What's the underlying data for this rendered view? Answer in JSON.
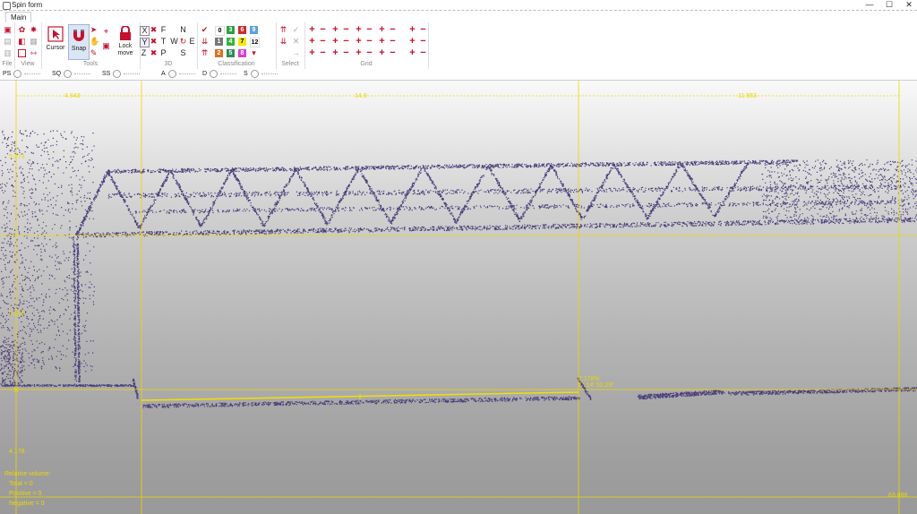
{
  "window": {
    "title": "Spin form",
    "buttons": {
      "minimize": "—",
      "maximize": "☐",
      "close": "✕"
    }
  },
  "tabs": [
    {
      "label": "Main"
    }
  ],
  "ribbon": {
    "groups": {
      "file": "File",
      "view": "View",
      "tools": "Tools",
      "three_d": "3D",
      "classification": "Classification",
      "select": "Select",
      "grid": "Grid"
    },
    "tools": {
      "cursor": "Cursor",
      "snap": "Snap",
      "lock_move": "Lock move"
    },
    "three_d": {
      "x": "X",
      "y": "Y",
      "z": "Z",
      "f": "F",
      "t": "T",
      "p": "P",
      "n": "N",
      "w": "W",
      "e": "E",
      "s": "S"
    },
    "classes": [
      {
        "label": "0",
        "color": "#ffffff",
        "text": "#000000"
      },
      {
        "label": "3",
        "color": "#2ea043",
        "text": "#ffffff"
      },
      {
        "label": "6",
        "color": "#d62828",
        "text": "#ffffff"
      },
      {
        "label": "9",
        "color": "#5aa0e0",
        "text": "#ffffff"
      },
      {
        "label": "1",
        "color": "#777777",
        "text": "#ffffff"
      },
      {
        "label": "4",
        "color": "#3cb043",
        "text": "#ffffff"
      },
      {
        "label": "7",
        "color": "#f5e600",
        "text": "#000000"
      },
      {
        "label": "12",
        "color": "#ffffff",
        "text": "#000000"
      },
      {
        "label": "2",
        "color": "#e07020",
        "text": "#ffffff"
      },
      {
        "label": "5",
        "color": "#2e8b57",
        "text": "#ffffff"
      },
      {
        "label": "8",
        "color": "#d63fd6",
        "text": "#ffffff"
      }
    ]
  },
  "filterbar": [
    {
      "label": "PS"
    },
    {
      "label": "SQ"
    },
    {
      "label": "SS"
    },
    {
      "label": "A"
    },
    {
      "label": "D"
    },
    {
      "label": "S"
    }
  ],
  "viewport": {
    "top_ruler": [
      "4.843",
      "14.9",
      "11.553"
    ],
    "left_ruler": [
      "5.279",
      "5.295",
      "4.178"
    ],
    "bottom_right": "63.888",
    "measurement": {
      "slope": "2.178%",
      "angle": "1° 14' 52.29\""
    },
    "volume": {
      "title": "Relative volume:",
      "total": "Total = 0",
      "positive": "Positive = 0",
      "negative": "Negative = 0"
    }
  },
  "colors": {
    "guides": "#e8d800",
    "points": "#4b3e7a",
    "measure": "#f0e000"
  }
}
